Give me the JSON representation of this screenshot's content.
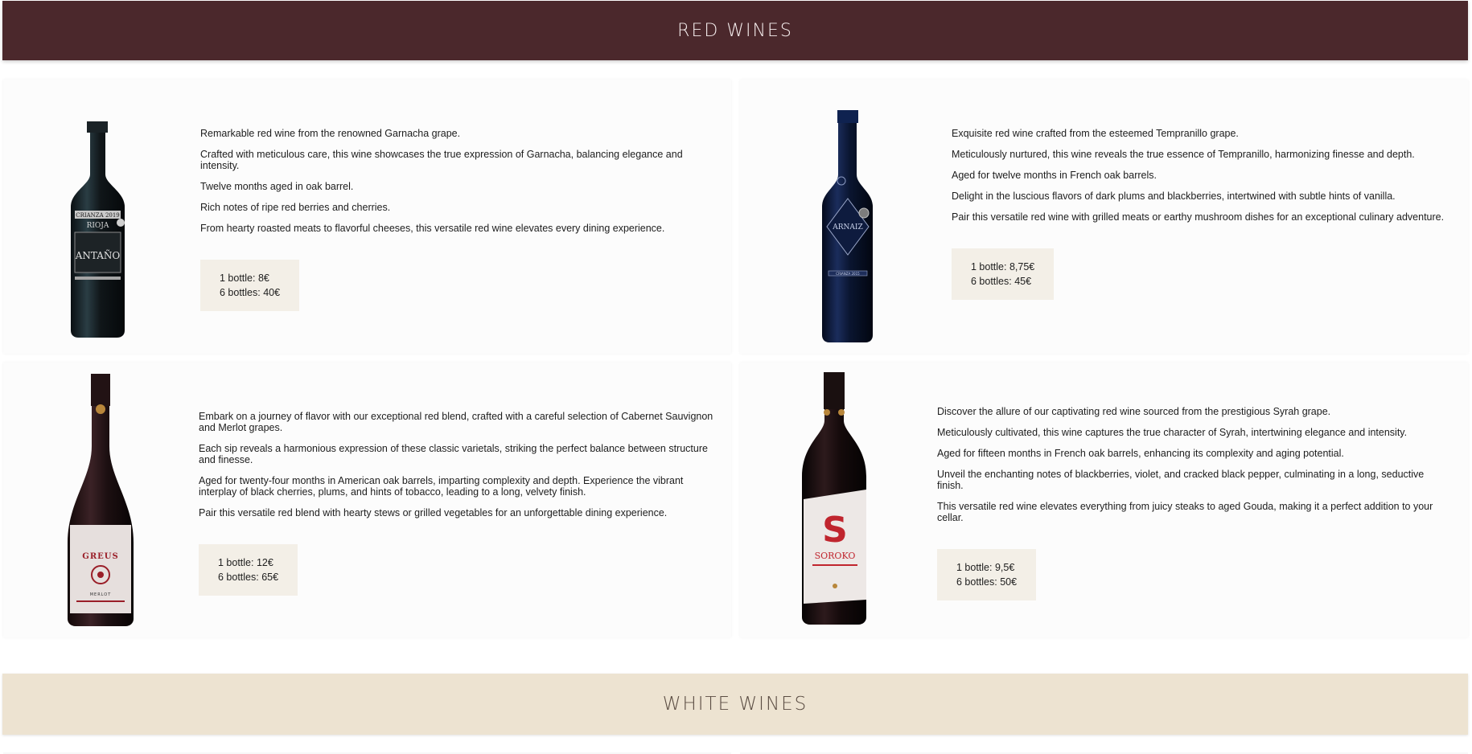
{
  "sections": {
    "red_title": "Red Wines",
    "white_title": "White Wines"
  },
  "colors": {
    "red_header_bg": "#4b282c",
    "white_header_bg": "#ede3d1",
    "price_box_bg": "#f3efe7"
  },
  "wines": [
    {
      "bottle_icon": "wine-bottle-icon",
      "label_text": [
        "CRIANZA 2019",
        "RIOJA",
        "ANTAÑO"
      ],
      "paragraphs": [
        "Remarkable red wine from the renowned Garnacha grape.",
        "Crafted with meticulous care, this wine showcases the true expression of Garnacha, balancing elegance and intensity.",
        "Twelve months aged in oak barrel.",
        "Rich notes of ripe red berries and cherries.",
        "From hearty roasted meats to flavorful cheeses, this versatile red wine elevates every dining experience."
      ],
      "price_1": "1 bottle: 8€",
      "price_6": "6 bottles: 40€"
    },
    {
      "bottle_icon": "wine-bottle-icon",
      "label_text": [
        "ARNAIZ",
        "CRIANZA 2015"
      ],
      "paragraphs": [
        "Exquisite red wine crafted from the esteemed Tempranillo grape.",
        "Meticulously nurtured, this wine reveals the true essence of Tempranillo, harmonizing finesse and depth.",
        "Aged for twelve months in French oak barrels.",
        "Delight in the luscious flavors of dark plums and blackberries, intertwined with subtle hints of vanilla.",
        "Pair this versatile red wine with grilled meats or earthy mushroom dishes for an exceptional culinary adventure."
      ],
      "price_1": "1 bottle: 8,75€",
      "price_6": "6 bottles: 45€"
    },
    {
      "bottle_icon": "wine-bottle-icon",
      "label_text": [
        "GREUS",
        "MERLOT"
      ],
      "paragraphs": [
        "Embark on a journey of flavor with our exceptional red blend, crafted with a careful selection of Cabernet Sauvignon and Merlot grapes.",
        "Each sip reveals a harmonious expression of these classic varietals, striking the perfect balance between structure and finesse.",
        "Aged for twenty-four months in American oak barrels, imparting complexity and depth. Experience the vibrant interplay of black cherries, plums, and hints of tobacco, leading to a long, velvety finish.",
        "Pair this versatile red blend with hearty stews or grilled vegetables for an unforgettable dining experience."
      ],
      "price_1": "1 bottle: 12€",
      "price_6": "6 bottles: 65€"
    },
    {
      "bottle_icon": "wine-bottle-icon",
      "label_text": [
        "S",
        "SOROKO"
      ],
      "paragraphs": [
        "Discover the allure of our captivating red wine sourced from the prestigious Syrah grape.",
        "Meticulously cultivated, this wine captures the true character of Syrah, intertwining elegance and intensity.",
        "Aged for fifteen months in French oak barrels, enhancing its complexity and aging potential.",
        "Unveil the enchanting notes of blackberries, violet, and cracked black pepper, culminating in a long, seductive finish.",
        "This versatile red wine elevates everything from juicy steaks to aged Gouda, making it a perfect addition to your cellar."
      ],
      "price_1": "1 bottle: 9,5€",
      "price_6": "6 bottles: 50€"
    }
  ]
}
